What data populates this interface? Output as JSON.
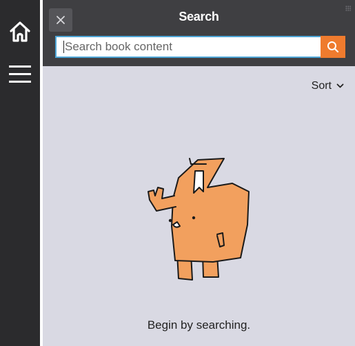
{
  "rail": {
    "home_icon": "home-icon",
    "menu_icon": "hamburger-menu-icon"
  },
  "panel": {
    "title": "Search",
    "close_icon": "close-icon"
  },
  "search": {
    "placeholder": "Search book content",
    "value": "",
    "button_icon": "search-icon"
  },
  "sort": {
    "label": "Sort",
    "icon": "chevron-down-icon"
  },
  "empty_state": {
    "message": "Begin by searching.",
    "illustration": "book-mascot-illustration"
  },
  "colors": {
    "rail_bg": "#2b2b2d",
    "header_bg": "#3f3f42",
    "panel_bg": "#d9d9e3",
    "accent": "#ef7b2e",
    "focus_border": "#4ea6d6",
    "mascot_fill": "#f2a05e"
  }
}
